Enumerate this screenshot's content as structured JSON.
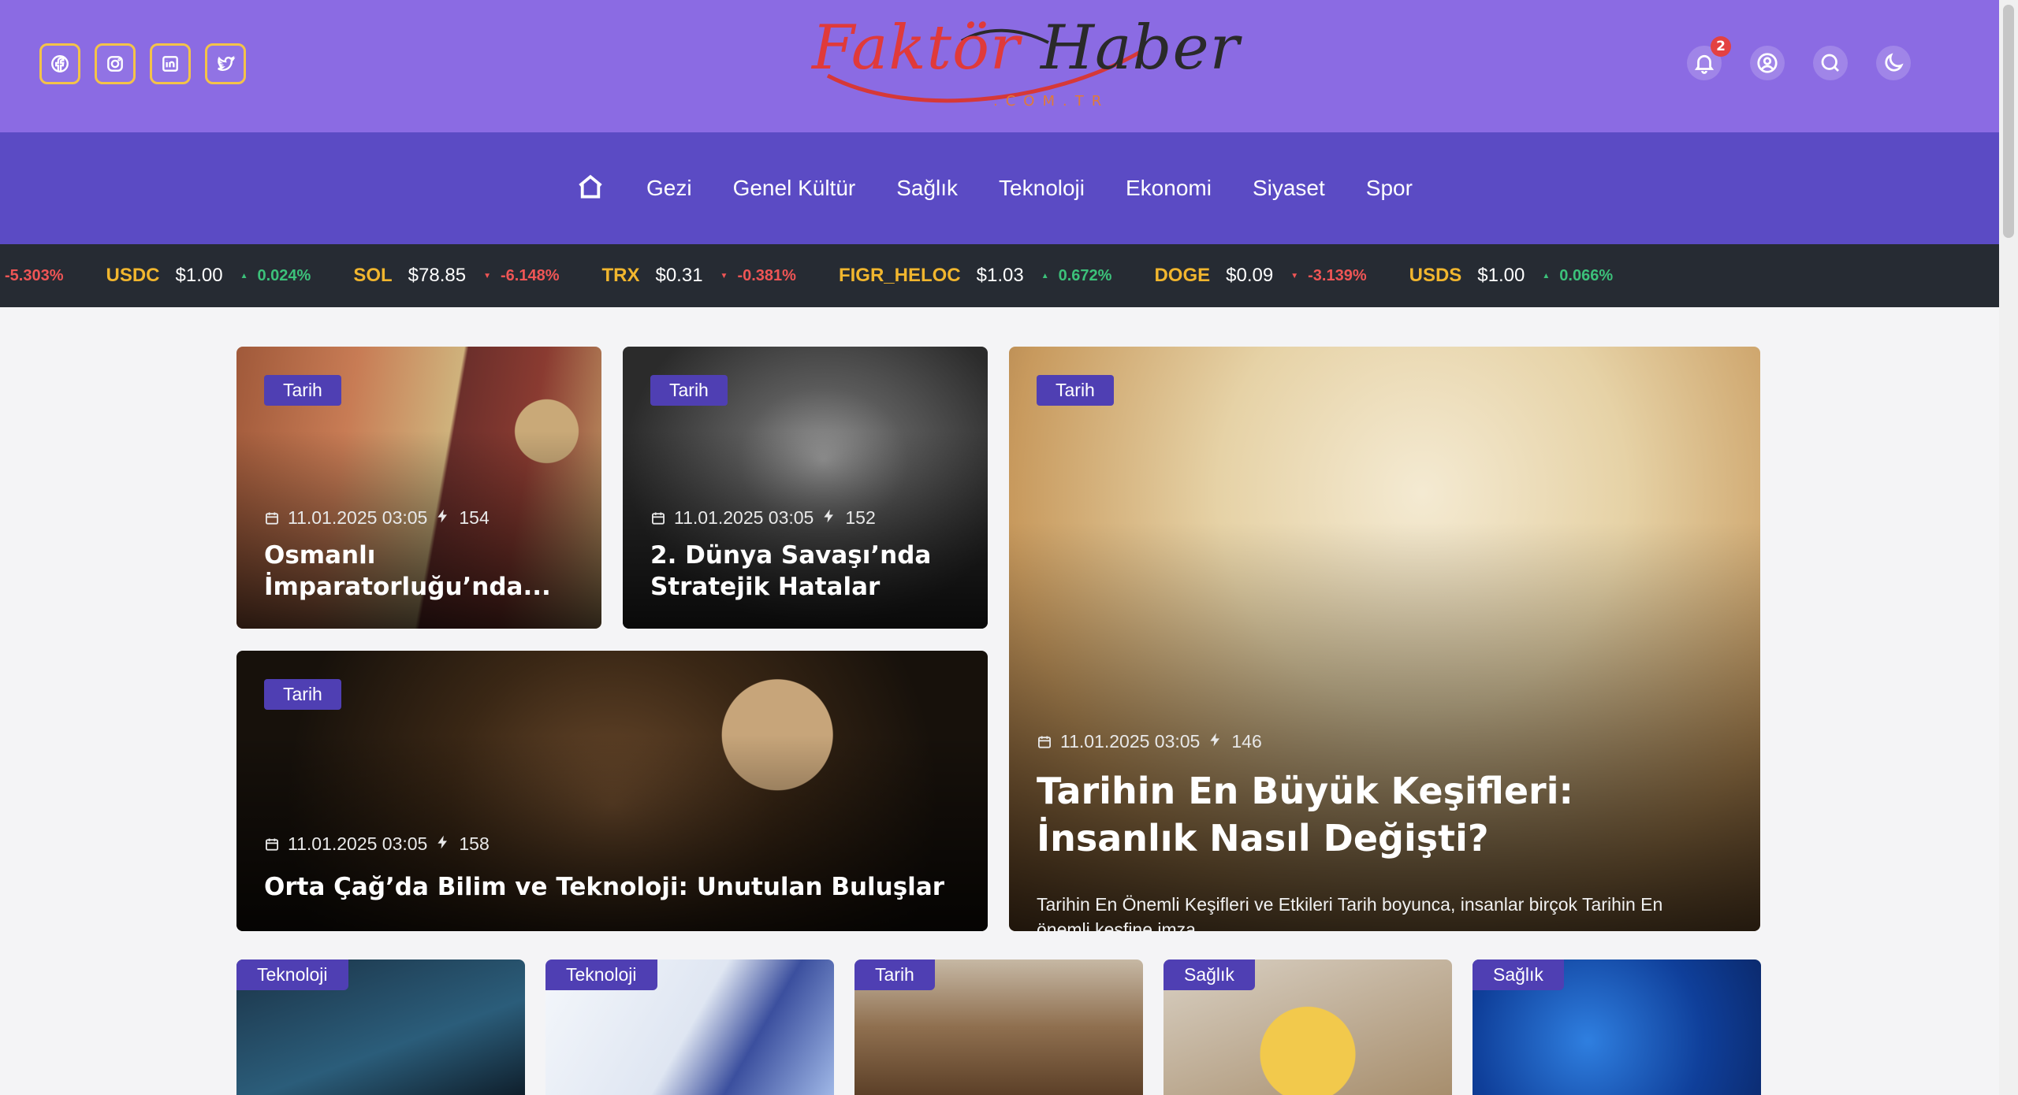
{
  "header": {
    "logo": {
      "text1": "Faktör",
      "text2": "Haber",
      "sub": ".COM.TR"
    },
    "social": [
      "facebook-icon",
      "instagram-icon",
      "linkedin-icon",
      "twitter-icon"
    ],
    "notification_count": "2",
    "colors": {
      "header_bg": "#8b6be3",
      "nav_bg": "#5b4bc4",
      "accent": "#f4c348"
    }
  },
  "nav": {
    "items": [
      {
        "label": "Gezi"
      },
      {
        "label": "Genel Kültür"
      },
      {
        "label": "Sağlık"
      },
      {
        "label": "Teknoloji"
      },
      {
        "label": "Ekonomi"
      },
      {
        "label": "Siyaset"
      },
      {
        "label": "Spor"
      }
    ]
  },
  "ticker": [
    {
      "symbol": "",
      "price": "",
      "change": "-5.303%",
      "dir": "down"
    },
    {
      "symbol": "USDC",
      "price": "$1.00",
      "change": "0.024%",
      "dir": "up"
    },
    {
      "symbol": "SOL",
      "price": "$78.85",
      "change": "-6.148%",
      "dir": "down"
    },
    {
      "symbol": "TRX",
      "price": "$0.31",
      "change": "-0.381%",
      "dir": "down"
    },
    {
      "symbol": "FIGR_HELOC",
      "price": "$1.03",
      "change": "0.672%",
      "dir": "up"
    },
    {
      "symbol": "DOGE",
      "price": "$0.09",
      "change": "-3.139%",
      "dir": "down"
    },
    {
      "symbol": "USDS",
      "price": "$1.00",
      "change": "0.066%",
      "dir": "up"
    }
  ],
  "featured": [
    {
      "tag": "Tarih",
      "date": "11.01.2025 03:05",
      "views": "154",
      "title": "Osmanlı İmparatorluğu’nda..."
    },
    {
      "tag": "Tarih",
      "date": "11.01.2025 03:05",
      "views": "152",
      "title": "2. Dünya Savaşı’nda Stratejik Hatalar"
    },
    {
      "tag": "Tarih",
      "date": "11.01.2025 03:05",
      "views": "158",
      "title": "Orta Çağ’da Bilim ve Teknoloji: Unutulan Buluşlar"
    },
    {
      "tag": "Tarih",
      "date": "11.01.2025 03:05",
      "views": "146",
      "title": "Tarihin En Büyük Keşifleri: İnsanlık Nasıl Değişti?",
      "excerpt": "Tarihin En Önemli Keşifleri ve Etkileri Tarih boyunca, insanlar birçok Tarihin En önemli keşfine imza..."
    }
  ],
  "small_cards": [
    {
      "tag": "Teknoloji"
    },
    {
      "tag": "Teknoloji"
    },
    {
      "tag": "Tarih"
    },
    {
      "tag": "Sağlık"
    },
    {
      "tag": "Sağlık"
    }
  ]
}
